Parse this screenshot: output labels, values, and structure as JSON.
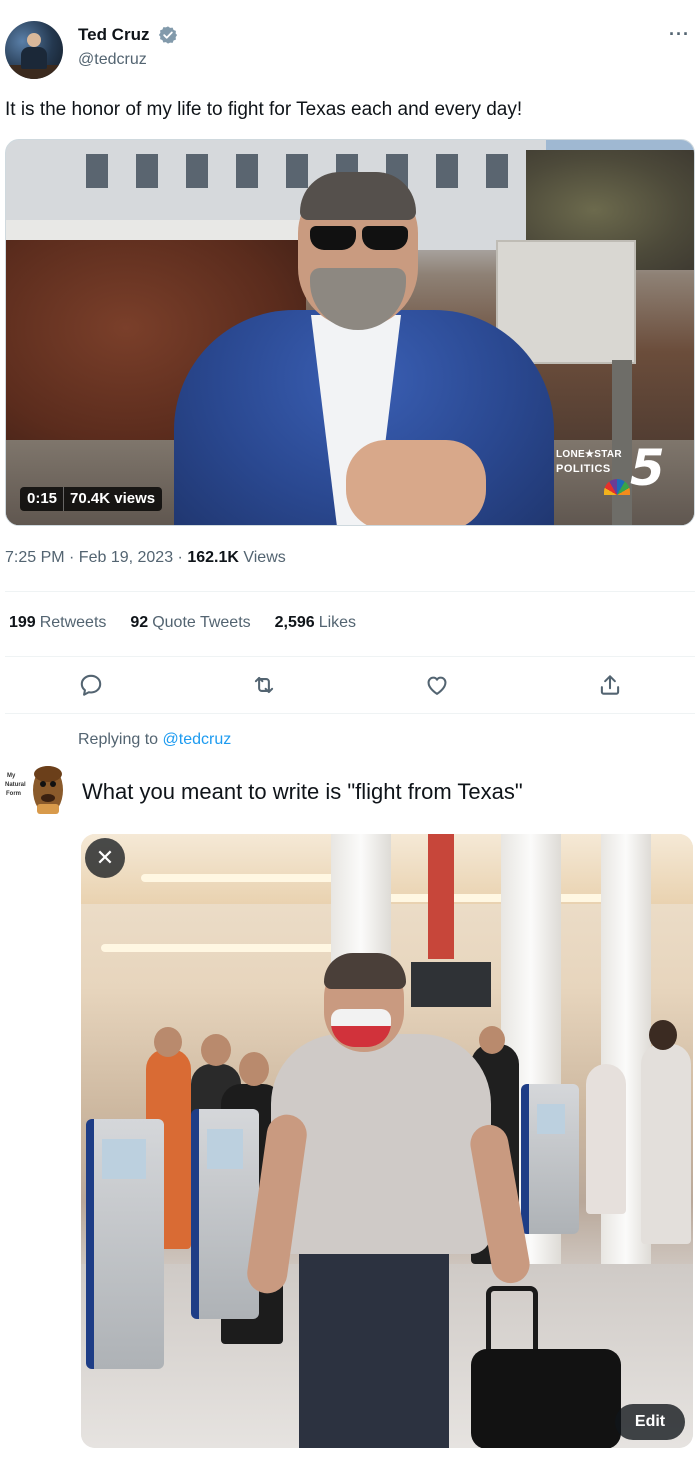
{
  "tweet": {
    "author": {
      "display_name": "Ted Cruz",
      "handle": "@tedcruz",
      "verified": true,
      "avatar_icon": "profile-photo"
    },
    "more_icon": "more-dots-icon",
    "text": "It is the honor of my life to fight for Texas each and every day!",
    "video": {
      "duration": "0:15",
      "views": "70.4K views",
      "channel_logo": {
        "line1": "LONE★STAR",
        "line2": "POLITICS",
        "number": "5"
      }
    },
    "timestamp": {
      "time_date": "7:25 PM · Feb 19, 2023 · ",
      "view_count": "162.1K",
      "view_label": " Views"
    },
    "stats": {
      "retweets": {
        "count": "199",
        "label": "Retweets"
      },
      "quote_tweets": {
        "count": "92",
        "label": "Quote Tweets"
      },
      "likes": {
        "count": "2,596",
        "label": "Likes"
      }
    },
    "actions": [
      "reply-icon",
      "retweet-icon",
      "like-icon",
      "share-icon"
    ]
  },
  "reply": {
    "replying_to_prefix": "Replying to ",
    "replying_to_mention": "@tedcruz",
    "avatar_caption": "My Natural Form",
    "text": "What you meant to write is \"flight from Texas\"",
    "photo": {
      "close_symbol": "✕",
      "edit_label": "Edit"
    }
  },
  "colors": {
    "text_primary": "#0f1419",
    "text_secondary": "#536471",
    "link": "#1d9bf0",
    "divider": "#eff3f4"
  }
}
